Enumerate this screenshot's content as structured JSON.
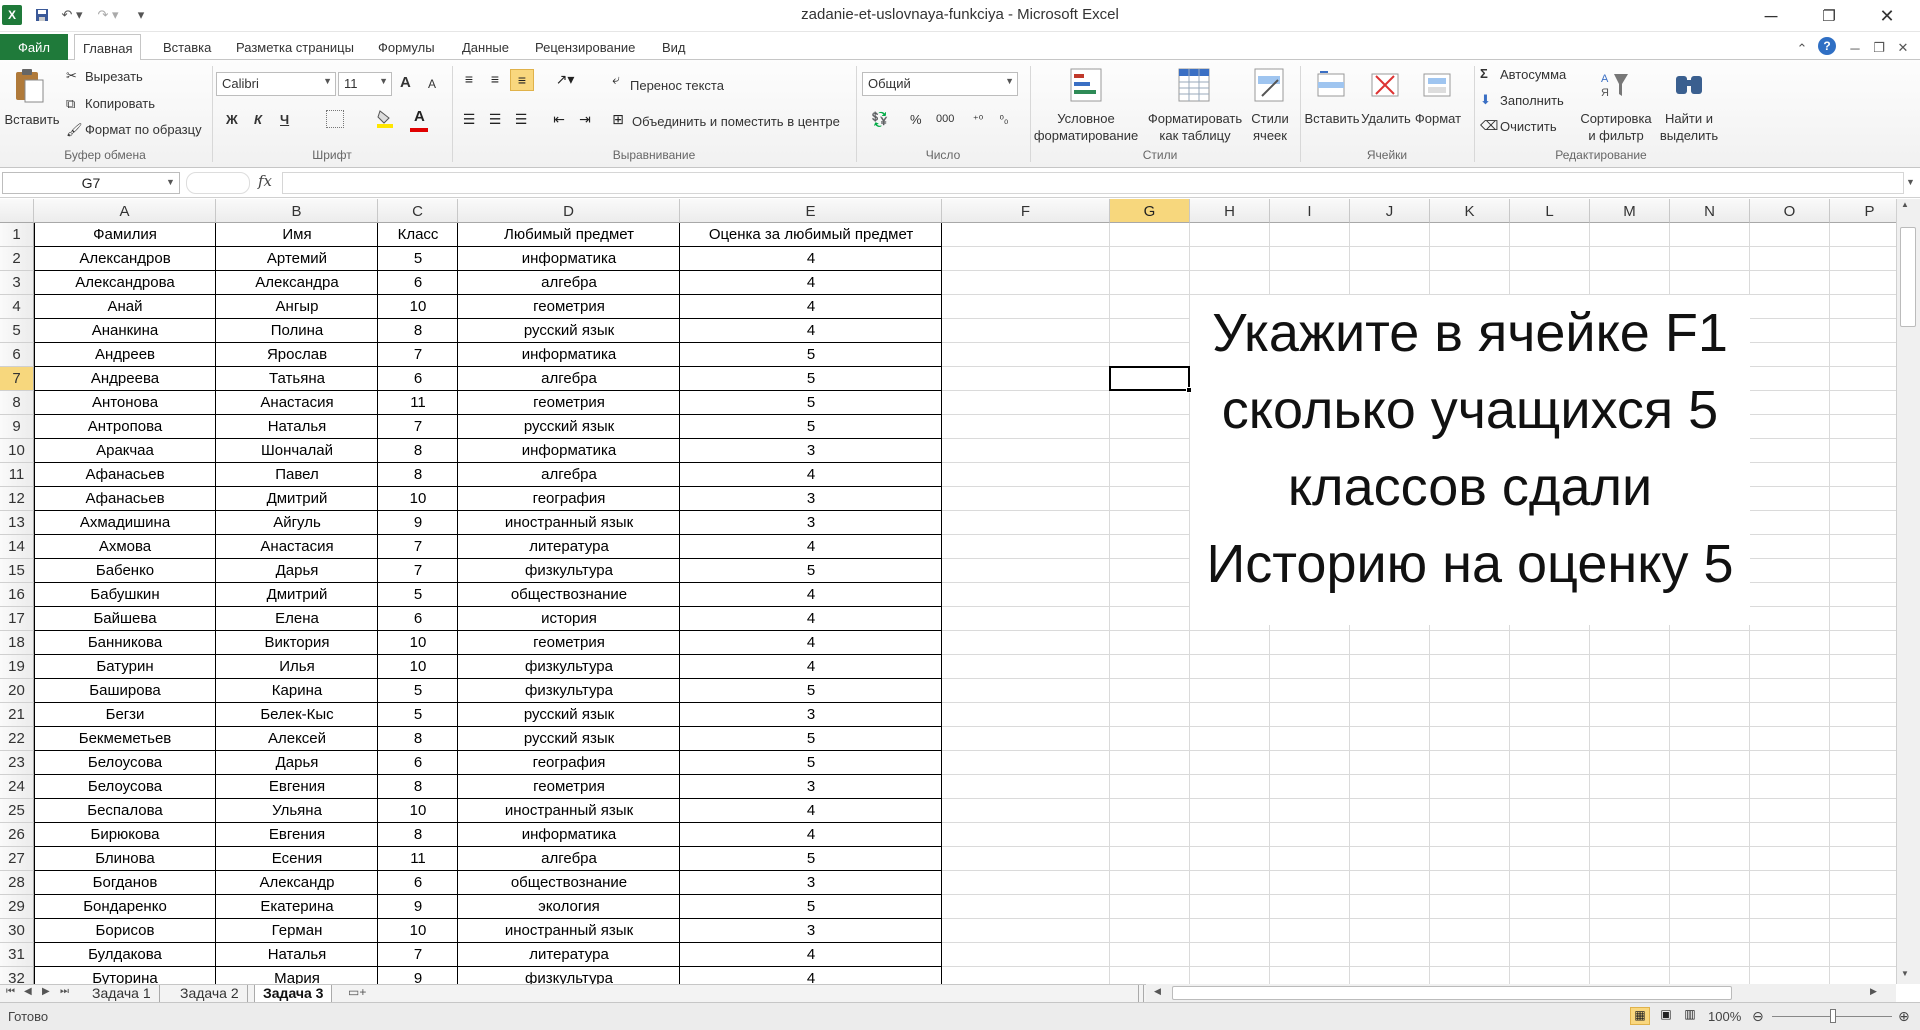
{
  "window": {
    "title": "zadanie-et-uslovnaya-funkciya  -  Microsoft Excel"
  },
  "tabs": [
    {
      "label": "Файл"
    },
    {
      "label": "Главная"
    },
    {
      "label": "Вставка"
    },
    {
      "label": "Разметка страницы"
    },
    {
      "label": "Формулы"
    },
    {
      "label": "Данные"
    },
    {
      "label": "Рецензирование"
    },
    {
      "label": "Вид"
    }
  ],
  "ribbon": {
    "clipboard": {
      "paste": "Вставить",
      "cut": "Вырезать",
      "copy": "Копировать",
      "format_painter": "Формат по образцу",
      "group": "Буфер обмена"
    },
    "font": {
      "name": "Calibri",
      "size": "11",
      "bold": "Ж",
      "italic": "К",
      "underline": "Ч",
      "grow": "A",
      "shrink": "A",
      "color_letter": "A",
      "group": "Шрифт"
    },
    "alignment": {
      "wrap": "Перенос текста",
      "merge": "Объединить и поместить в центре",
      "group": "Выравнивание"
    },
    "number": {
      "format": "Общий",
      "percent": "%",
      "thousands": "000",
      "group": "Число"
    },
    "styles": {
      "conditional": [
        "Условное",
        "форматирование"
      ],
      "as_table": [
        "Форматировать",
        "как таблицу"
      ],
      "cell_styles": [
        "Стили",
        "ячеек"
      ],
      "group": "Стили"
    },
    "cells": {
      "insert": "Вставить",
      "delete": "Удалить",
      "format": "Формат",
      "group": "Ячейки"
    },
    "editing": {
      "autosum": "Автосумма",
      "fill": "Заполнить",
      "clear": "Очистить",
      "sort": [
        "Сортировка",
        "и фильтр"
      ],
      "find": [
        "Найти и",
        "выделить"
      ],
      "group": "Редактирование"
    }
  },
  "formula_bar": {
    "name_box": "G7",
    "fx": "fx",
    "formula": ""
  },
  "columns": [
    "A",
    "B",
    "C",
    "D",
    "E",
    "F",
    "G",
    "H",
    "I",
    "J",
    "K",
    "L",
    "M",
    "N",
    "O",
    "P"
  ],
  "selected": {
    "column": "G",
    "row": 7
  },
  "row_numbers": [
    "1",
    "2",
    "3",
    "4",
    "5",
    "6",
    "7",
    "8",
    "9",
    "10",
    "11",
    "12",
    "13",
    "14",
    "15",
    "16",
    "17",
    "18",
    "19",
    "20",
    "21",
    "22",
    "23",
    "24",
    "25",
    "26",
    "27",
    "28",
    "29",
    "30",
    "31",
    "32"
  ],
  "table": {
    "headers": [
      "Фамилия",
      "Имя",
      "Класс",
      "Любимый предмет",
      "Оценка за любимый предмет"
    ],
    "rows": [
      [
        "Александров",
        "Артемий",
        "5",
        "информатика",
        "4"
      ],
      [
        "Александрова",
        "Александра",
        "6",
        "алгебра",
        "4"
      ],
      [
        "Анай",
        "Ангыр",
        "10",
        "геометрия",
        "4"
      ],
      [
        "Ананкина",
        "Полина",
        "8",
        "русский язык",
        "4"
      ],
      [
        "Андреев",
        "Ярослав",
        "7",
        "информатика",
        "5"
      ],
      [
        "Андреева",
        "Татьяна",
        "6",
        "алгебра",
        "5"
      ],
      [
        "Антонова",
        "Анастасия",
        "11",
        "геометрия",
        "5"
      ],
      [
        "Антропова",
        "Наталья",
        "7",
        "русский язык",
        "5"
      ],
      [
        "Аракчаа",
        "Шончалай",
        "8",
        "информатика",
        "3"
      ],
      [
        "Афанасьев",
        "Павел",
        "8",
        "алгебра",
        "4"
      ],
      [
        "Афанасьев",
        "Дмитрий",
        "10",
        "география",
        "3"
      ],
      [
        "Ахмадишина",
        "Айгуль",
        "9",
        "иностранный язык",
        "3"
      ],
      [
        "Ахмова",
        "Анастасия",
        "7",
        "литература",
        "4"
      ],
      [
        "Бабенко",
        "Дарья",
        "7",
        "физкультура",
        "5"
      ],
      [
        "Бабушкин",
        "Дмитрий",
        "5",
        "обществознание",
        "4"
      ],
      [
        "Байшева",
        "Елена",
        "6",
        "история",
        "4"
      ],
      [
        "Банникова",
        "Виктория",
        "10",
        "геометрия",
        "4"
      ],
      [
        "Батурин",
        "Илья",
        "10",
        "физкультура",
        "4"
      ],
      [
        "Баширова",
        "Карина",
        "5",
        "физкультура",
        "5"
      ],
      [
        "Бегзи",
        "Белек-Кыс",
        "5",
        "русский язык",
        "3"
      ],
      [
        "Бекмеметьев",
        "Алексей",
        "8",
        "русский язык",
        "5"
      ],
      [
        "Белоусова",
        "Дарья",
        "6",
        "география",
        "5"
      ],
      [
        "Белоусова",
        "Евгения",
        "8",
        "геометрия",
        "3"
      ],
      [
        "Беспалова",
        "Ульяна",
        "10",
        "иностранный язык",
        "4"
      ],
      [
        "Бирюкова",
        "Евгения",
        "8",
        "информатика",
        "4"
      ],
      [
        "Блинова",
        "Есения",
        "11",
        "алгебра",
        "5"
      ],
      [
        "Богданов",
        "Александр",
        "6",
        "обществознание",
        "3"
      ],
      [
        "Бондаренко",
        "Екатерина",
        "9",
        "экология",
        "5"
      ],
      [
        "Борисов",
        "Герман",
        "10",
        "иностранный язык",
        "3"
      ],
      [
        "Булдакова",
        "Наталья",
        "7",
        "литература",
        "4"
      ],
      [
        "Буторина",
        "Мария",
        "9",
        "физкультура",
        "4"
      ]
    ]
  },
  "note": {
    "lines": [
      "Укажите в ячейке F1",
      "сколько учащихся 5",
      "классов сдали",
      "Историю на оценку 5"
    ]
  },
  "sheets": [
    {
      "label": "Задача 1"
    },
    {
      "label": "Задача 2"
    },
    {
      "label": "Задача 3"
    }
  ],
  "status": {
    "ready": "Готово",
    "zoom": "100%"
  }
}
